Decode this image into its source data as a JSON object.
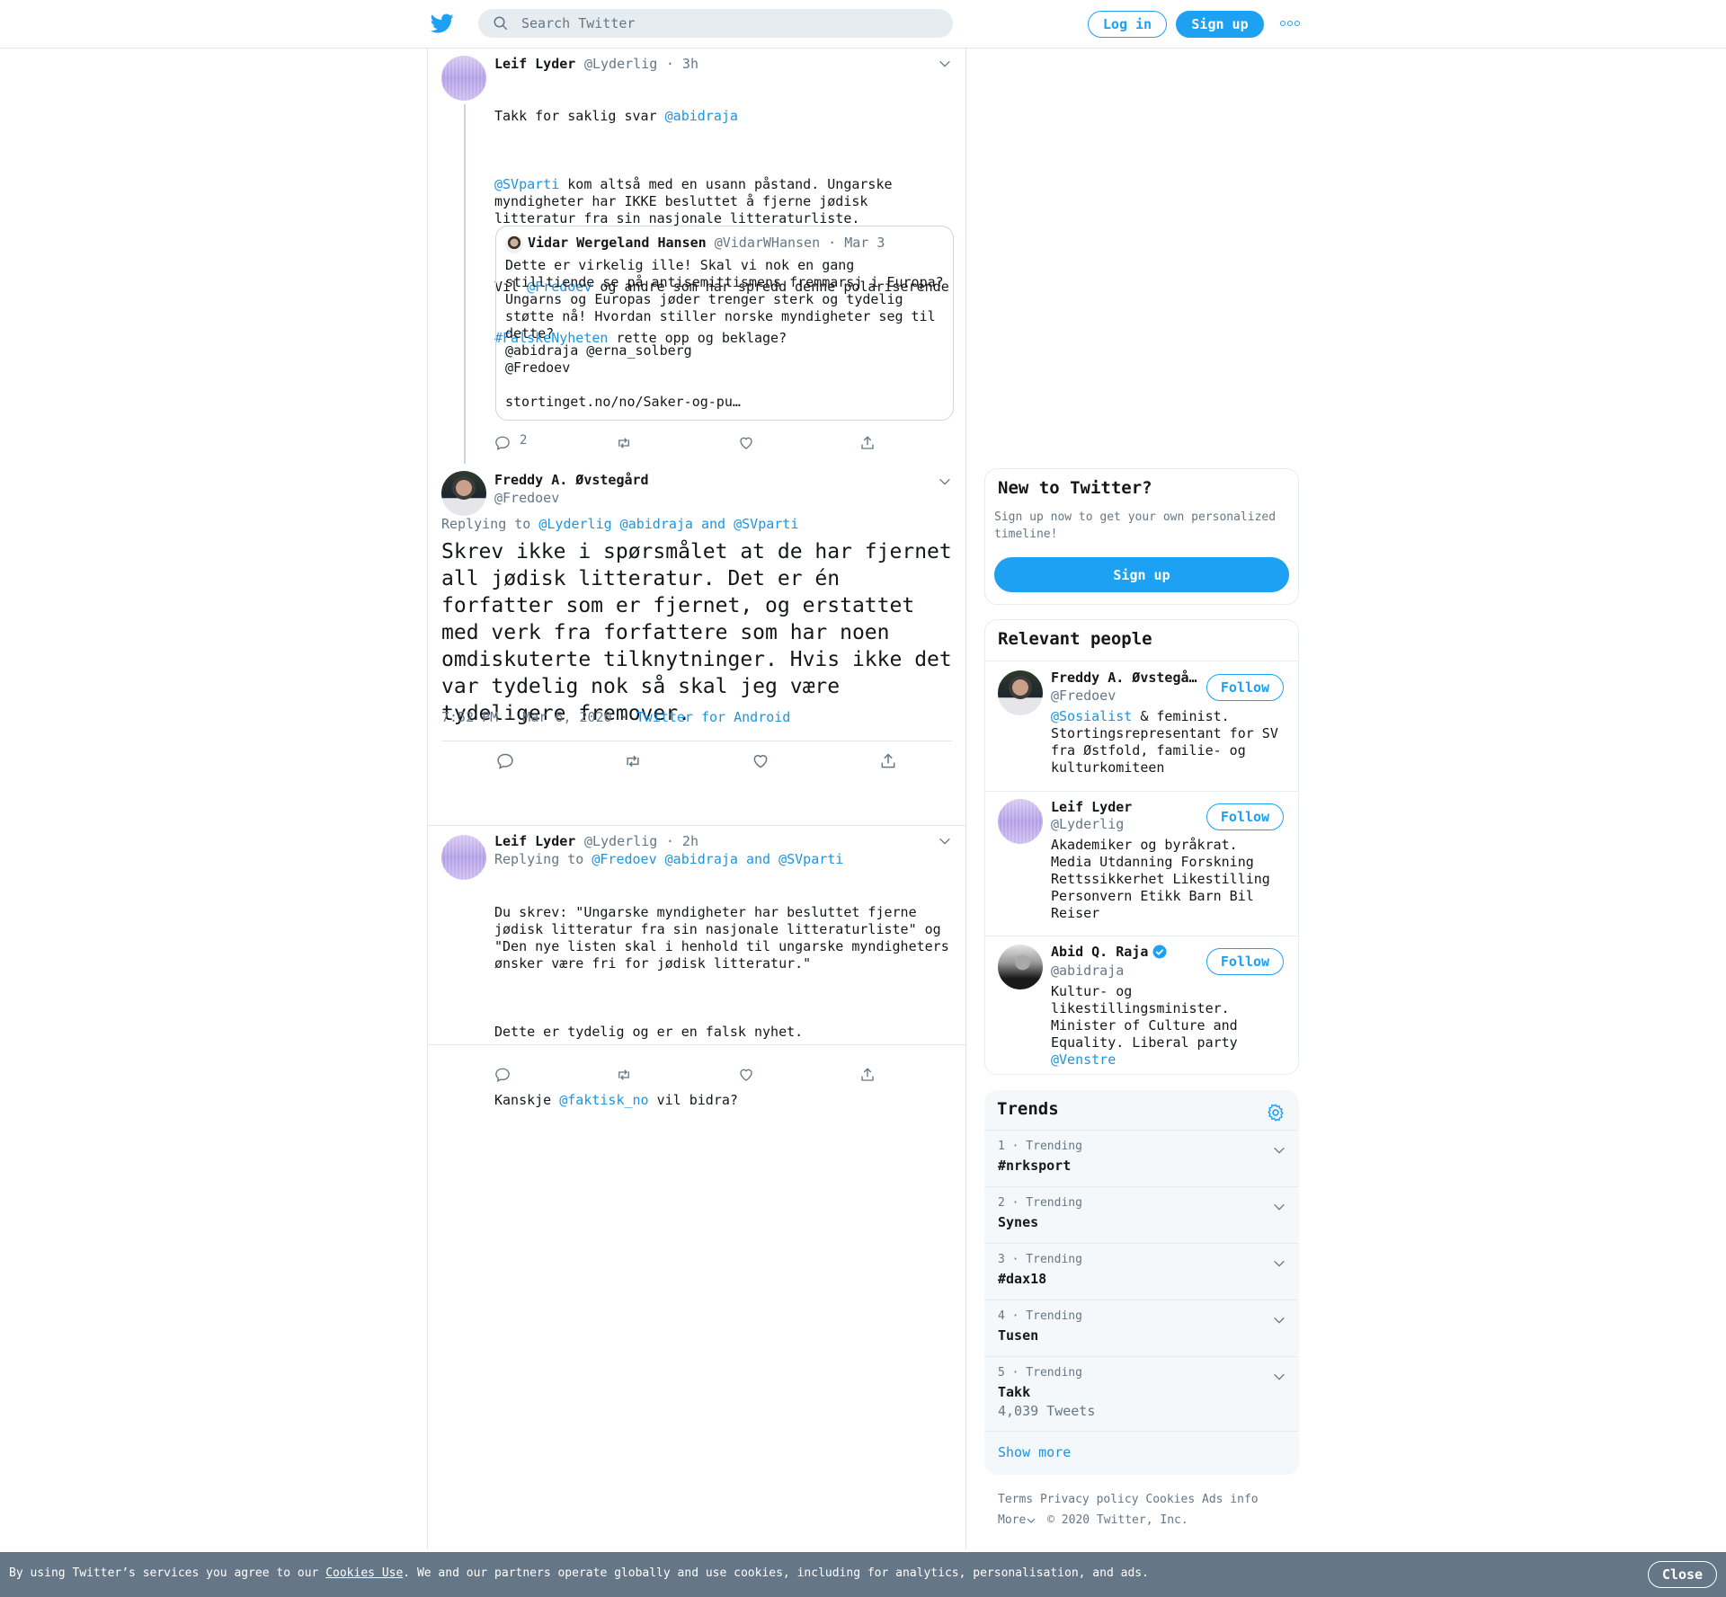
{
  "header": {
    "search_placeholder": "Search Twitter",
    "login_label": "Log in",
    "signup_label": "Sign up",
    "logo_icon": "twitter-bird-icon",
    "accent_color": "#1da1f2"
  },
  "tweets": {
    "first": {
      "name": "Leif Lyder",
      "handle": "@Lyderlig",
      "time": "· 3h",
      "line1_text": "Takk for saklig svar ",
      "line1_mention": "@abidraja",
      "p1_mention": "@SVparti",
      "p1_text": " kom altså med en usann påstand. Ungarske\nmyndigheter har IKKE besluttet å fjerne jødisk\nlitteratur fra sin nasjonale litteraturliste.",
      "p2_pre": "Vil ",
      "p2_mention": "@Fredoev",
      "p2_text": " og andre som har spredd denne polariserende",
      "p2_hashtag": "#FalskeNyheten",
      "p2_post": " rette opp og beklage?",
      "quote": {
        "name": "Vidar Wergeland Hansen",
        "handle": "@VidarWHansen",
        "date": "· Mar 3",
        "text": "Dette er virkelig ille! Skal vi nok en gang\nstilltiende se på antisemittismens fremmarsj i Europa?\nUngarns og Europas jøder trenger sterk og tydelig\nstøtte nå! Hvordan stiller norske myndigheter seg til\ndette?\n@abidraja @erna_solberg\n@Fredoev\n\nstortinget.no/no/Saker-og-pu…"
      },
      "reply_count": "2"
    },
    "main": {
      "name": "Freddy A. Øvstegård",
      "handle": "@Fredoev",
      "replying_prefix": "Replying to ",
      "replying_mentions": "@Lyderlig @abidraja and @SVparti",
      "text": "Skrev ikke i spørsmålet at de har fjernet\nall jødisk litteratur. Det er én\nforfatter som er fjernet, og erstattet\nmed verk fra forfattere som har noen\nomdiskuterte tilknytninger. Hvis ikke det\nvar tydelig nok så skal jeg være\ntydeligere fremover.",
      "timestamp": "7:52 PM · Mar 6, 2020 ·",
      "source": "Twitter for Android"
    },
    "reply": {
      "name": "Leif Lyder",
      "handle": "@Lyderlig",
      "time": "· 2h",
      "replying_prefix": "Replying to ",
      "replying_mentions": "@Fredoev @abidraja and @SVparti",
      "p1": "Du skrev: \"Ungarske myndigheter har besluttet fjerne\njødisk litteratur fra sin nasjonale litteraturliste\" og\n\"Den nye listen skal i henhold til ungarske myndigheters\nønsker være fri for jødisk litteratur.\"",
      "p2": "Dette er tydelig og er en falsk nyhet.",
      "p3_pre": "Kanskje ",
      "p3_mention": "@faktisk_no",
      "p3_post": " vil bidra?"
    }
  },
  "sidebar": {
    "new_to_twitter": {
      "title": "New to Twitter?",
      "text": "Sign up now to get your own personalized\ntimeline!",
      "button": "Sign up"
    },
    "relevant_people": {
      "title": "Relevant people",
      "people": [
        {
          "name": "Freddy A. Øvstegå…",
          "handle": "@Fredoev",
          "bio_mention": "@Sosialist",
          "bio": " & feminist.\nStortingsrepresentant for SV\nfra Østfold, familie- og\nkulturkomiteen",
          "follow": "Follow"
        },
        {
          "name": "Leif Lyder",
          "handle": "@Lyderlig",
          "bio": "Akademiker og byråkrat.\nMedia Utdanning Forskning\nRettssikkerhet Likestilling\nPersonvern Etikk Barn Bil\nReiser",
          "follow": "Follow"
        },
        {
          "name": "Abid Q. Raja",
          "handle": "@abidraja",
          "bio": "Kultur- og\nlikestillingsminister.\nMinister of Culture and\nEquality. Liberal party",
          "bio_mention": "@Venstre",
          "follow": "Follow"
        }
      ]
    },
    "trends": {
      "title": "Trends",
      "items": [
        {
          "meta": "1 · Trending",
          "name": "#nrksport"
        },
        {
          "meta": "2 · Trending",
          "name": "Synes"
        },
        {
          "meta": "3 · Trending",
          "name": "#dax18"
        },
        {
          "meta": "4 · Trending",
          "name": "Tusen"
        },
        {
          "meta": "5 · Trending",
          "name": "Takk",
          "count": "4,039 Tweets"
        }
      ],
      "show_more": "Show more"
    },
    "footer": {
      "links": [
        "Terms",
        "Privacy policy",
        "Cookies",
        "Ads info"
      ],
      "more": "More",
      "copyright": "© 2020 Twitter, Inc."
    }
  },
  "cookie_bar": {
    "text_pre": "By using Twitter’s services you agree to our ",
    "link": "Cookies Use",
    "text_post": ". We and our partners operate globally and use cookies, including for analytics, personalisation, and ads.",
    "close": "Close"
  }
}
